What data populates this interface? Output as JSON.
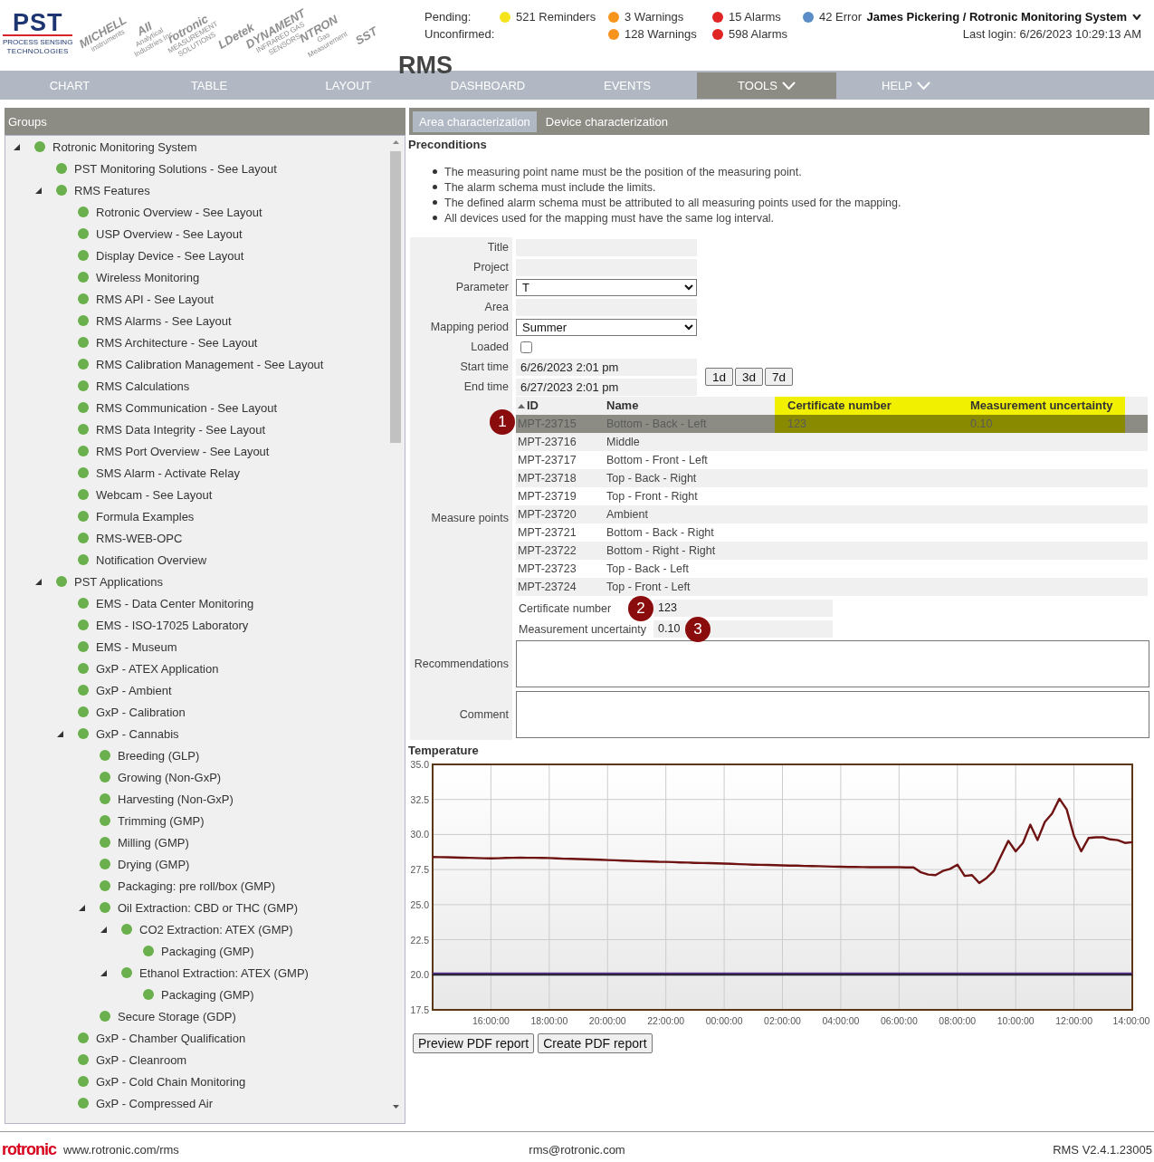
{
  "header": {
    "main_logo": {
      "name": "PST",
      "line_1": "PROCESS SENSING",
      "line_2": "TECHNOLOGIES"
    },
    "brand_logos": [
      {
        "name": "MICHELL",
        "tagline": "instruments"
      },
      {
        "name": "AII",
        "tagline": "Analytical Industries Inc"
      },
      {
        "name": "rotronic",
        "tagline": "MEASUREMENT SOLUTIONS"
      },
      {
        "name": "LDetek"
      },
      {
        "name": "DYNAMENT",
        "tagline": "INFRARED GAS SENSORS"
      },
      {
        "name": "NTRON",
        "tagline": "Gas Measurement"
      },
      {
        "name": "SST"
      }
    ],
    "app_title": "RMS",
    "status": {
      "pending_label": "Pending:",
      "unconfirmed_label": "Unconfirmed:",
      "groups": [
        {
          "color": "#f5e31b",
          "pending": "521 Reminders"
        },
        {
          "color": "#f7941d",
          "pending": "3 Warnings",
          "unconfirmed": "128 Warnings"
        },
        {
          "color": "#e02424",
          "pending": "15 Alarms",
          "unconfirmed": "598 Alarms"
        },
        {
          "color": "#5b8ec8",
          "pending": "42 Error"
        }
      ]
    },
    "user": {
      "name": "James Pickering / Rotronic Monitoring System",
      "last_login": "Last login: 6/26/2023 10:29:13 AM"
    }
  },
  "nav": [
    {
      "label": "CHART",
      "selected": false,
      "dropdown": false
    },
    {
      "label": "TABLE",
      "selected": false,
      "dropdown": false
    },
    {
      "label": "LAYOUT",
      "selected": false,
      "dropdown": false
    },
    {
      "label": "DASHBOARD",
      "selected": false,
      "dropdown": false
    },
    {
      "label": "EVENTS",
      "selected": false,
      "dropdown": false
    },
    {
      "label": "TOOLS",
      "selected": true,
      "dropdown": true
    },
    {
      "label": "HELP",
      "selected": false,
      "dropdown": true
    }
  ],
  "sidebar": {
    "title": "Groups",
    "tree": [
      {
        "label": "Rotronic Monitoring System",
        "expanded": true,
        "children": [
          {
            "label": "PST Monitoring Solutions - See Layout"
          },
          {
            "label": "RMS Features",
            "expanded": true,
            "children": [
              {
                "label": "Rotronic Overview - See Layout"
              },
              {
                "label": "USP Overview - See Layout"
              },
              {
                "label": "Display Device - See Layout"
              },
              {
                "label": "Wireless Monitoring"
              },
              {
                "label": "RMS API - See Layout"
              },
              {
                "label": "RMS Alarms - See Layout"
              },
              {
                "label": "RMS Architecture - See Layout"
              },
              {
                "label": "RMS Calibration Management - See Layout"
              },
              {
                "label": "RMS Calculations"
              },
              {
                "label": "RMS Communication - See Layout"
              },
              {
                "label": "RMS Data Integrity - See Layout"
              },
              {
                "label": "RMS Port Overview - See Layout"
              },
              {
                "label": "SMS Alarm - Activate Relay"
              },
              {
                "label": "Webcam - See Layout"
              },
              {
                "label": "Formula Examples"
              },
              {
                "label": "RMS-WEB-OPC"
              },
              {
                "label": "Notification Overview"
              }
            ]
          },
          {
            "label": "PST Applications",
            "expanded": true,
            "children": [
              {
                "label": "EMS - Data Center Monitoring"
              },
              {
                "label": "EMS - ISO-17025 Laboratory"
              },
              {
                "label": "EMS - Museum"
              },
              {
                "label": "GxP - ATEX Application"
              },
              {
                "label": "GxP - Ambient"
              },
              {
                "label": "GxP - Calibration"
              },
              {
                "label": "GxP - Cannabis",
                "expanded": true,
                "children": [
                  {
                    "label": "Breeding (GLP)"
                  },
                  {
                    "label": "Growing (Non-GxP)"
                  },
                  {
                    "label": "Harvesting (Non-GxP)"
                  },
                  {
                    "label": "Trimming (GMP)"
                  },
                  {
                    "label": "Milling (GMP)"
                  },
                  {
                    "label": "Drying (GMP)"
                  },
                  {
                    "label": "Packaging: pre roll/box (GMP)"
                  },
                  {
                    "label": "Oil Extraction: CBD or THC (GMP)",
                    "expanded": true,
                    "children": [
                      {
                        "label": "CO2 Extraction: ATEX (GMP)",
                        "expanded": true,
                        "children": [
                          {
                            "label": "Packaging (GMP)"
                          }
                        ]
                      },
                      {
                        "label": "Ethanol Extraction: ATEX (GMP)",
                        "expanded": true,
                        "children": [
                          {
                            "label": "Packaging (GMP)"
                          }
                        ]
                      }
                    ]
                  },
                  {
                    "label": "Secure Storage (GDP)"
                  }
                ]
              },
              {
                "label": "GxP - Chamber Qualification"
              },
              {
                "label": "GxP - Cleanroom"
              },
              {
                "label": "GxP - Cold Chain Monitoring"
              },
              {
                "label": "GxP - Compressed Air"
              }
            ]
          }
        ]
      }
    ]
  },
  "tabs": [
    {
      "label": "Area characterization",
      "selected": true
    },
    {
      "label": "Device characterization",
      "selected": false
    }
  ],
  "preconditions": {
    "title": "Preconditions",
    "items": [
      "The measuring point name must be the position of the measuring point.",
      "The alarm schema must include the limits.",
      "The defined alarm schema must be attributed to all measuring points used for the mapping.",
      "All devices used for the mapping must have the same log interval."
    ]
  },
  "form": {
    "fields": [
      {
        "kind": "text",
        "label": "Title"
      },
      {
        "kind": "text",
        "label": "Project"
      },
      {
        "kind": "select",
        "label": "Parameter",
        "value": "T"
      },
      {
        "kind": "text",
        "label": "Area"
      },
      {
        "kind": "select",
        "label": "Mapping period",
        "value": "Summer"
      },
      {
        "kind": "checkbox",
        "label": "Loaded",
        "checked": false
      }
    ],
    "range": {
      "start_label": "Start time",
      "start": "6/26/2023 2:01 pm",
      "end_label": "End time",
      "end": "6/27/2023 2:01 pm",
      "presets": [
        "1d",
        "3d",
        "7d"
      ]
    },
    "measure_points": {
      "label": "Measure points",
      "columns": [
        {
          "label": "ID",
          "sorted": true,
          "highlighted": false
        },
        {
          "label": "Name",
          "sorted": false,
          "highlighted": false
        },
        {
          "label": "Certificate number",
          "sorted": false,
          "highlighted": true
        },
        {
          "label": "Measurement uncertainty",
          "sorted": false,
          "highlighted": true
        }
      ],
      "rows": [
        {
          "cells": [
            "MPT-23715",
            "Bottom - Back - Left",
            "123",
            "0.10"
          ],
          "selected": true,
          "callout": "1"
        },
        {
          "cells": [
            "MPT-23716",
            "Middle"
          ],
          "selected": false
        },
        {
          "cells": [
            "MPT-23717",
            "Bottom - Front - Left"
          ],
          "selected": false
        },
        {
          "cells": [
            "MPT-23718",
            "Top - Back - Right"
          ],
          "selected": false
        },
        {
          "cells": [
            "MPT-23719",
            "Top - Front - Right"
          ],
          "selected": false
        },
        {
          "cells": [
            "MPT-23720",
            "Ambient"
          ],
          "selected": false
        },
        {
          "cells": [
            "MPT-23721",
            "Bottom - Back - Right"
          ],
          "selected": false
        },
        {
          "cells": [
            "MPT-23722",
            "Bottom - Right - Right"
          ],
          "selected": false
        },
        {
          "cells": [
            "MPT-23723",
            "Top - Back - Left"
          ],
          "selected": false
        },
        {
          "cells": [
            "MPT-23724",
            "Top - Front - Left"
          ],
          "selected": false
        }
      ],
      "details": [
        {
          "label": "Certificate number",
          "value": "123",
          "callout": "2"
        },
        {
          "label": "Measurement uncertainty",
          "value": "0.10",
          "callout": "3"
        }
      ]
    },
    "notes": [
      {
        "label": "Recommendations"
      },
      {
        "label": "Comment"
      }
    ]
  },
  "chart": {
    "chart_data": {
      "type": "line",
      "title": "Temperature",
      "grid": true,
      "categories": [
        null,
        null,
        null,
        null,
        null,
        null,
        null,
        null,
        "16:00:00",
        null,
        null,
        null,
        null,
        null,
        null,
        null,
        "18:00:00",
        null,
        null,
        null,
        null,
        null,
        null,
        null,
        "20:00:00",
        null,
        null,
        null,
        null,
        null,
        null,
        null,
        "22:00:00",
        null,
        null,
        null,
        null,
        null,
        null,
        null,
        "00:00:00",
        null,
        null,
        null,
        null,
        null,
        null,
        null,
        "02:00:00",
        null,
        null,
        null,
        null,
        null,
        null,
        null,
        "04:00:00",
        null,
        null,
        null,
        null,
        null,
        null,
        null,
        "06:00:00",
        null,
        null,
        null,
        null,
        null,
        null,
        null,
        "08:00:00",
        null,
        null,
        null,
        null,
        null,
        null,
        null,
        "10:00:00",
        null,
        null,
        null,
        null,
        null,
        null,
        null,
        "12:00:00",
        null,
        null,
        null,
        null,
        null,
        null,
        null,
        "14:00:00"
      ],
      "series": [
        {
          "color": "#6e1212",
          "values": [
            28.4,
            28.39,
            28.38,
            28.36,
            28.35,
            28.34,
            28.32,
            28.31,
            28.3,
            28.31,
            28.33,
            28.34,
            28.35,
            28.34,
            28.34,
            28.33,
            28.32,
            28.3,
            28.28,
            28.27,
            28.25,
            28.23,
            28.22,
            28.2,
            28.18,
            28.16,
            28.14,
            28.12,
            28.1,
            28.09,
            28.08,
            28.06,
            28.05,
            28.03,
            28.01,
            28,
            27.98,
            27.97,
            27.96,
            27.94,
            27.93,
            27.91,
            27.89,
            27.87,
            27.85,
            27.84,
            27.83,
            27.81,
            27.8,
            27.79,
            27.78,
            27.76,
            27.75,
            27.74,
            27.73,
            27.71,
            27.7,
            27.69,
            27.69,
            27.68,
            27.67,
            27.67,
            27.67,
            27.67,
            27.67,
            27.66,
            27.65,
            27.3,
            27.15,
            27.1,
            27.4,
            27.55,
            27.85,
            27.05,
            27.1,
            26.55,
            26.9,
            27.4,
            28.5,
            29.55,
            28.8,
            29.4,
            30.7,
            29.6,
            30.9,
            31.5,
            32.55,
            31.8,
            29.9,
            28.8,
            29.75,
            29.8,
            29.8,
            29.65,
            29.6,
            29.4,
            29.45
          ]
        },
        {
          "color": "#5a2d86",
          "values": [
            20.1,
            20.1,
            20.1,
            20.1,
            20.1,
            20.1,
            20.1,
            20.1,
            20.1,
            20.1,
            20.1,
            20.1,
            20.1,
            20.1,
            20.1,
            20.1,
            20.1,
            20.1,
            20.1,
            20.1,
            20.1,
            20.1,
            20.1,
            20.1,
            20.1,
            20.1,
            20.1,
            20.1,
            20.1,
            20.1,
            20.1,
            20.1,
            20.1,
            20.1,
            20.1,
            20.1,
            20.1,
            20.1,
            20.1,
            20.1,
            20.1,
            20.1,
            20.1,
            20.1,
            20.1,
            20.1,
            20.1,
            20.1,
            20.1,
            20.1,
            20.1,
            20.1,
            20.1,
            20.1,
            20.1,
            20.1,
            20.1,
            20.1,
            20.1,
            20.1,
            20.1,
            20.1,
            20.1,
            20.1,
            20.1,
            20.1,
            20.1,
            20.1,
            20.1,
            20.1,
            20.1,
            20.1,
            20.1,
            20.1,
            20.1,
            20.1,
            20.1,
            20.1,
            20.1,
            20.1,
            20.1,
            20.1,
            20.1,
            20.1,
            20.1,
            20.1,
            20.1,
            20.1,
            20.1,
            20.1,
            20.1,
            20.1,
            20.1,
            20.1,
            20.1,
            20.1,
            20.1
          ]
        },
        {
          "color": "#1e1e30",
          "values": [
            20,
            20,
            20,
            20,
            20,
            20,
            20,
            20,
            20,
            20,
            20,
            20,
            20,
            20,
            20,
            20,
            20,
            20,
            20,
            20,
            20,
            20,
            20,
            20,
            20,
            20,
            20,
            20,
            20,
            20,
            20,
            20,
            20,
            20,
            20,
            20,
            20,
            20,
            20,
            20,
            20,
            20,
            20,
            20,
            20,
            20,
            20,
            20,
            20,
            20,
            20,
            20,
            20,
            20,
            20,
            20,
            20,
            20,
            20,
            20,
            20,
            20,
            20,
            20,
            20,
            20,
            20,
            20,
            20,
            20,
            20,
            20,
            20,
            20,
            20,
            20,
            20,
            20,
            20,
            20,
            20,
            20,
            20,
            20,
            20,
            20,
            20,
            20,
            20,
            20,
            20,
            20,
            20,
            20,
            20,
            20,
            20
          ]
        }
      ],
      "ylim": [
        17.5,
        35
      ],
      "yticks": [
        17.5,
        {
          "value": 20,
          "label": "20.0"
        },
        22.5,
        {
          "value": 25,
          "label": "25.0"
        },
        27.5,
        {
          "value": 30,
          "label": "30.0"
        },
        32.5,
        {
          "value": 35,
          "label": "35.0"
        }
      ]
    }
  },
  "report_buttons": [
    "Preview PDF report",
    "Create PDF report"
  ],
  "footer": {
    "logo": "rotronic",
    "website": "www.rotronic.com/rms",
    "email": "rms@rotronic.com",
    "version": "RMS V2.4.1.23005"
  }
}
